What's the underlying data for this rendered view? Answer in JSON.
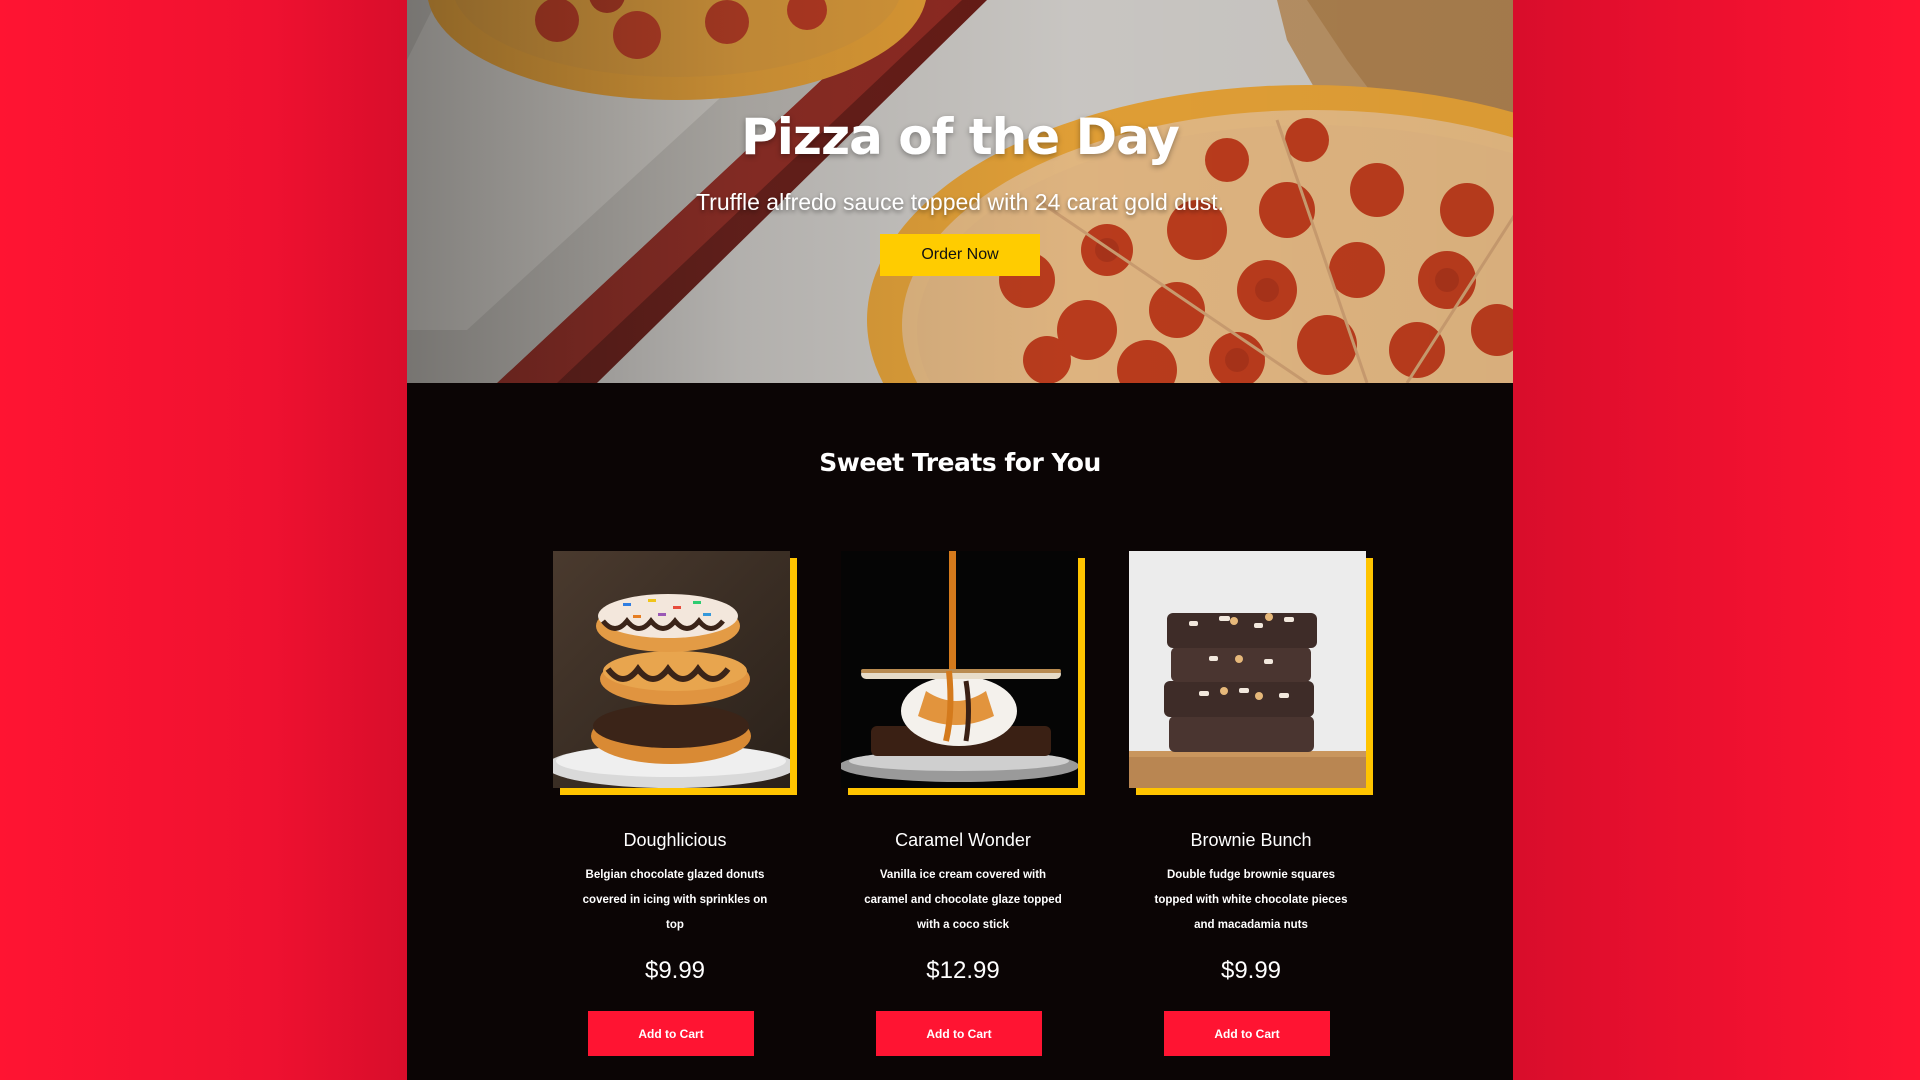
{
  "colors": {
    "background": "#ff1432",
    "page": "#0b0505",
    "accent_yellow": "#ffcc00",
    "accent_red": "#ff1432"
  },
  "hero": {
    "title": "Pizza of the Day",
    "subtitle": "Truffle alfredo sauce topped with 24 carat gold dust.",
    "cta_label": "Order Now",
    "image_icon": "pizza-photo"
  },
  "treats": {
    "heading": "Sweet Treats for You",
    "items": [
      {
        "name": "Doughlicious",
        "description": "Belgian chocolate glazed donuts covered in icing with sprinkles on top",
        "price": "$9.99",
        "button_label": "Add to Cart",
        "image_icon": "donuts-photo"
      },
      {
        "name": "Caramel Wonder",
        "description": "Vanilla ice cream covered with caramel and chocolate glaze topped with a coco stick",
        "price": "$12.99",
        "button_label": "Add to Cart",
        "image_icon": "ice-cream-photo"
      },
      {
        "name": "Brownie Bunch",
        "description": "Double fudge brownie squares topped with white chocolate pieces and macadamia nuts",
        "price": "$9.99",
        "button_label": "Add to Cart",
        "image_icon": "brownies-photo"
      }
    ]
  }
}
